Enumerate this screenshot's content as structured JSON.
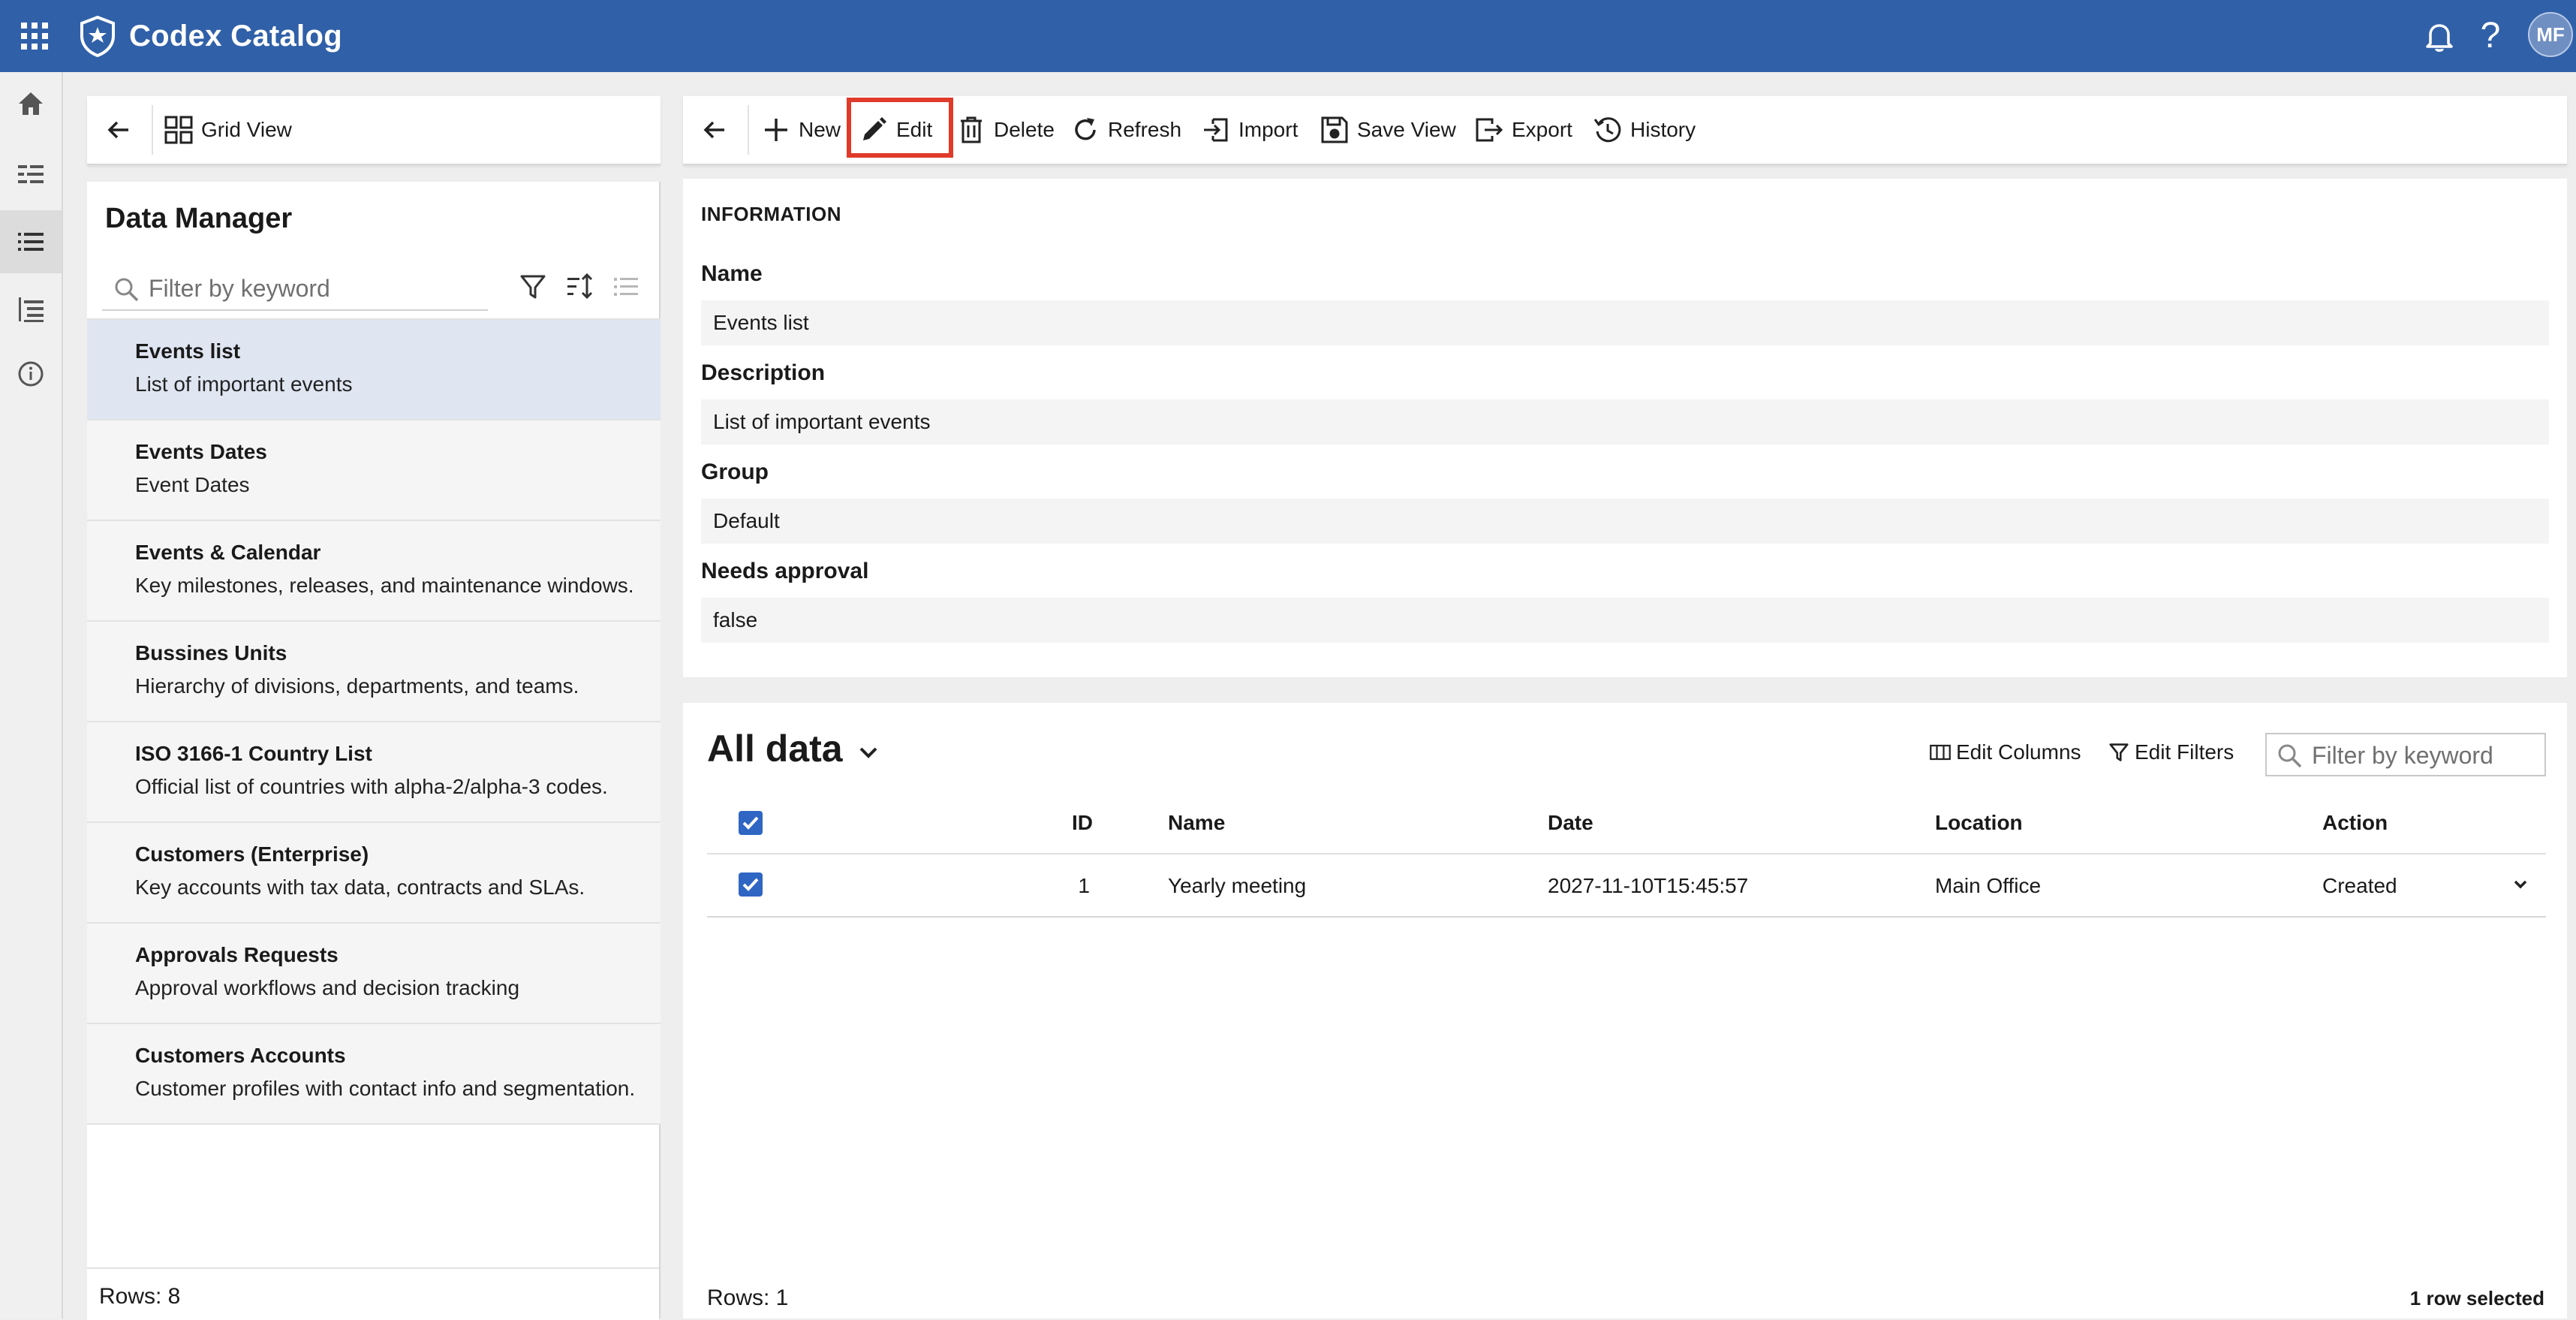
{
  "app": {
    "title": "Codex Catalog",
    "user_initials": "MF",
    "help_glyph": "?",
    "brand_color": "#3060a8"
  },
  "left_panel": {
    "back_icon": "arrow-left-icon",
    "view_label": "Grid View",
    "title": "Data Manager",
    "search_placeholder": "Filter by keyword",
    "items": [
      {
        "title": "Events list",
        "description": "List of important events"
      },
      {
        "title": "Events Dates",
        "description": "Event Dates"
      },
      {
        "title": "Events & Calendar",
        "description": "Key milestones, releases, and maintenance windows."
      },
      {
        "title": "Bussines Units",
        "description": "Hierarchy of divisions, departments, and teams."
      },
      {
        "title": "ISO 3166-1 Country List",
        "description": "Official list of countries with alpha-2/alpha-3 codes."
      },
      {
        "title": "Customers (Enterprise)",
        "description": "Key accounts with tax data, contracts and SLAs."
      },
      {
        "title": "Approvals Requests",
        "description": "Approval workflows and decision tracking"
      },
      {
        "title": "Customers Accounts",
        "description": "Customer profiles with contact info and segmentation."
      }
    ],
    "rows_label": "Rows: 8"
  },
  "toolbar": {
    "new": "New",
    "edit": "Edit",
    "delete": "Delete",
    "refresh": "Refresh",
    "import": "Import",
    "save_view": "Save View",
    "export": "Export",
    "history": "History",
    "highlight_color": "#e03a2a"
  },
  "information": {
    "section_title": "INFORMATION",
    "fields": [
      {
        "label": "Name",
        "value": "Events list"
      },
      {
        "label": "Description",
        "value": "List of important events"
      },
      {
        "label": "Group",
        "value": "Default"
      },
      {
        "label": "Needs approval",
        "value": "false"
      }
    ]
  },
  "grid": {
    "title": "All data",
    "edit_columns": "Edit Columns",
    "edit_filters": "Edit Filters",
    "search_placeholder": "Filter by keyword",
    "columns": [
      "ID",
      "Name",
      "Date",
      "Location",
      "Action"
    ],
    "rows": [
      {
        "id": "1",
        "name": "Yearly meeting",
        "date": "2027-11-10T15:45:57",
        "location": "Main Office",
        "action": "Created",
        "checked": true
      }
    ],
    "rows_label": "Rows: 1",
    "selected_label": "1 row selected"
  }
}
